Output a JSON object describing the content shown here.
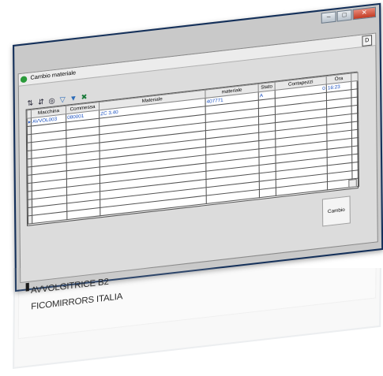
{
  "window": {
    "title": "Cambio materiale",
    "d_button": "D",
    "controls": [
      "minimize",
      "maximize",
      "close"
    ]
  },
  "toolbar": {
    "icons": [
      "sort-asc-icon",
      "sort-desc-icon",
      "binoculars-icon",
      "filter-icon",
      "filter-clear-icon",
      "excel-export-icon"
    ]
  },
  "table": {
    "headers": [
      "Macchina",
      "Commessa",
      "Materiale",
      "materiale",
      "Stato",
      "Contapezzi",
      "Ora"
    ],
    "rows": [
      [
        "AVVOL003",
        "080001",
        "ZC 3.40",
        "407771",
        "A",
        "0",
        "16:23"
      ]
    ]
  },
  "buttons": {
    "cambio": "Cambio"
  },
  "machine": {
    "name": "AVVOLGITRICE B2",
    "company": "FICOMIRRORS ITALIA"
  },
  "colors": {
    "window_border": "#14305a",
    "selected_text": "#1a50c0",
    "app_icon": "#2a9a3a"
  }
}
